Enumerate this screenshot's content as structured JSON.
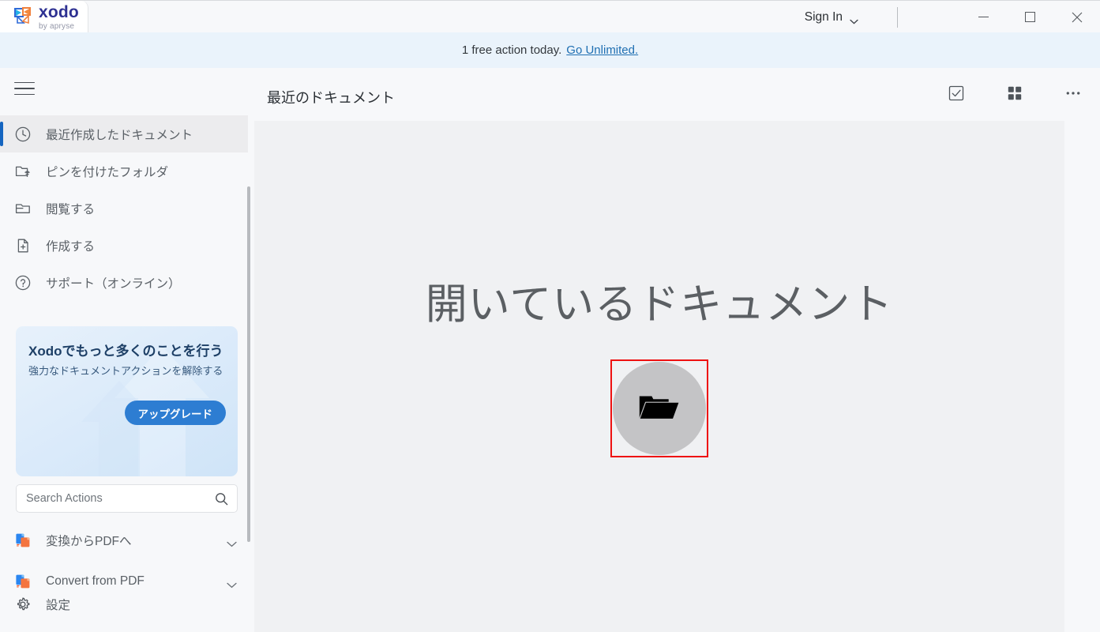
{
  "window": {
    "brand": {
      "name": "xodo",
      "tagline": "by apryse",
      "icon": "xodo-logo-icon"
    },
    "signin_label": "Sign In",
    "controls": {
      "minimize": "minimize-icon",
      "maximize": "maximize-icon",
      "close": "close-icon"
    }
  },
  "promo_bar": {
    "text": "1 free action today.",
    "link": "Go Unlimited."
  },
  "sidebar": {
    "menu_icon": "hamburger-icon",
    "items": [
      {
        "label": "最近作成したドキュメント",
        "icon": "clock-icon",
        "active": true
      },
      {
        "label": "ピンを付けたフォルダ",
        "icon": "folder-pin-icon",
        "active": false
      },
      {
        "label": "閲覧する",
        "icon": "folder-open-icon",
        "active": false
      },
      {
        "label": "作成する",
        "icon": "file-plus-icon",
        "active": false
      },
      {
        "label": "サポート（オンライン）",
        "icon": "help-circle-icon",
        "active": false
      }
    ],
    "promo_card": {
      "title": "Xodoでもっと多くのことを行う",
      "subtitle": "強力なドキュメントアクションを解除する",
      "button": "アップグレード"
    },
    "search": {
      "placeholder": "Search Actions",
      "value": "",
      "icon": "search-icon"
    },
    "actions": [
      {
        "label": "変換からPDFへ",
        "icon": "convert-docs-icon",
        "chevron": "chevron-down-icon"
      },
      {
        "label": "Convert from PDF",
        "icon": "convert-docs-icon",
        "chevron": "chevron-down-icon"
      }
    ],
    "settings": {
      "label": "設定",
      "icon": "gear-icon"
    }
  },
  "main": {
    "title": "最近のドキュメント",
    "header_actions": [
      {
        "name": "select-checkbox",
        "icon": "checkbox-checked-icon"
      },
      {
        "name": "grid-view",
        "icon": "grid-icon"
      },
      {
        "name": "more-options",
        "icon": "ellipsis-icon"
      }
    ],
    "empty_state": {
      "title": "開いているドキュメント",
      "open_button_icon": "folder-open-icon",
      "highlight_color": "#ee1111"
    }
  },
  "colors": {
    "accent": "#1565c0",
    "link": "#1f6fb2",
    "brand": "#2e3192",
    "promo_button": "#2d7dd2",
    "panel": "#f0f1f3"
  }
}
